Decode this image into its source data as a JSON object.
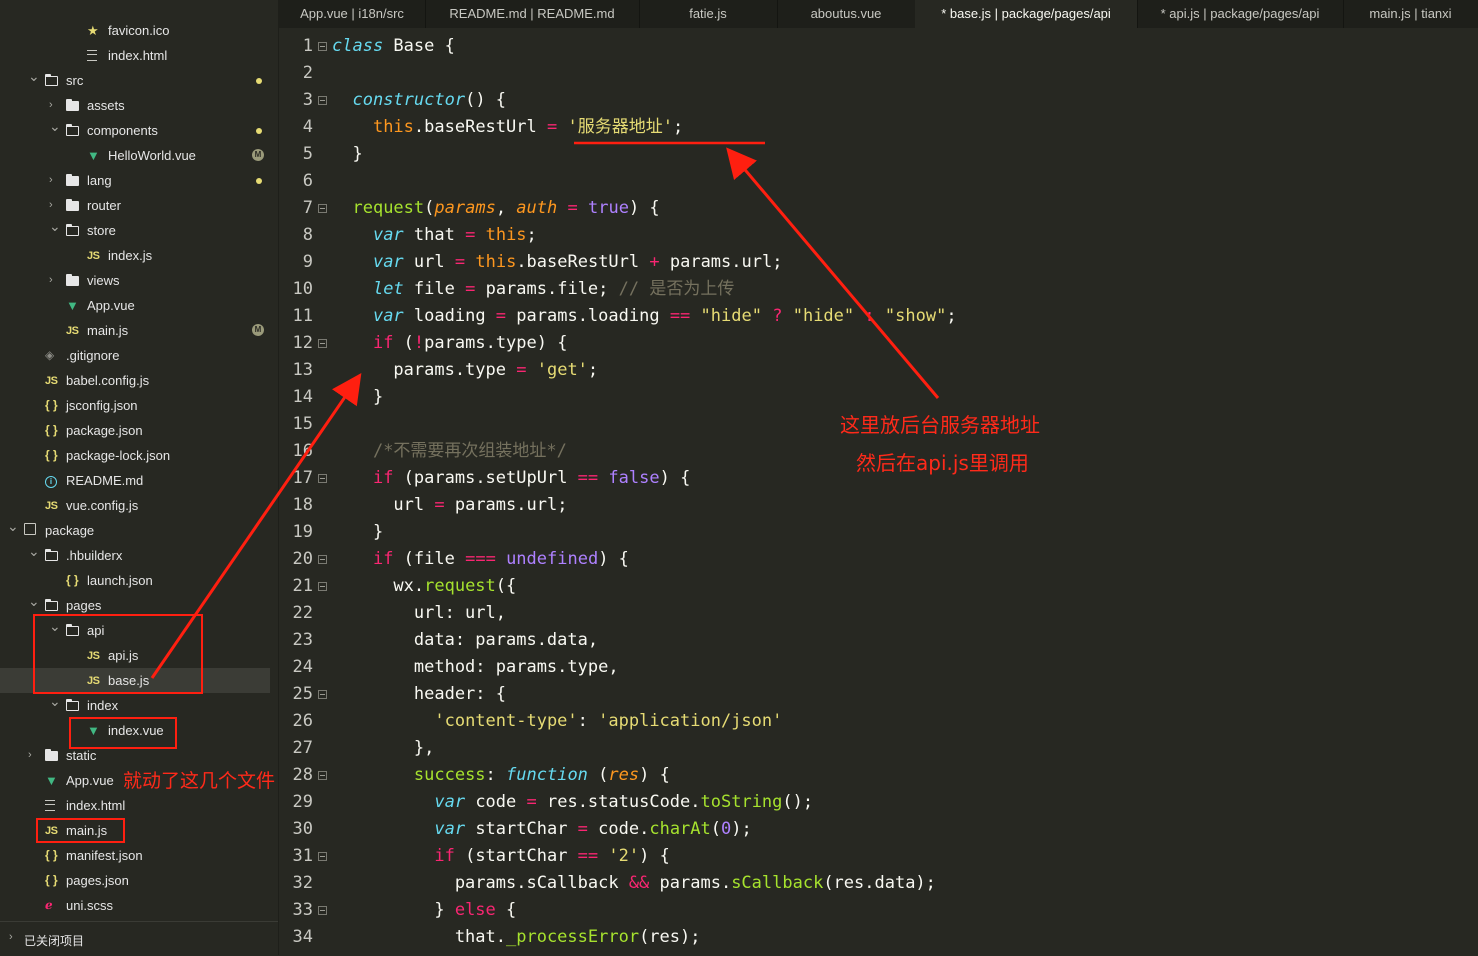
{
  "sidebar": {
    "items": [
      {
        "label": "favicon.ico",
        "icon": "star-icon",
        "indent": 4,
        "chevron": "none",
        "badge": ""
      },
      {
        "label": "index.html",
        "icon": "html-file-icon",
        "indent": 4,
        "chevron": "none",
        "badge": ""
      },
      {
        "label": "src",
        "icon": "folder-open-icon",
        "indent": 2,
        "chevron": "down",
        "badge": "dot"
      },
      {
        "label": "assets",
        "icon": "folder-icon",
        "indent": 3,
        "chevron": "right",
        "badge": ""
      },
      {
        "label": "components",
        "icon": "folder-open-icon",
        "indent": 3,
        "chevron": "down",
        "badge": "dot"
      },
      {
        "label": "HelloWorld.vue",
        "icon": "vue-file-icon",
        "indent": 4,
        "chevron": "none",
        "badge": "M"
      },
      {
        "label": "lang",
        "icon": "folder-icon",
        "indent": 3,
        "chevron": "right",
        "badge": "dot"
      },
      {
        "label": "router",
        "icon": "folder-icon",
        "indent": 3,
        "chevron": "right",
        "badge": ""
      },
      {
        "label": "store",
        "icon": "folder-open-icon",
        "indent": 3,
        "chevron": "down",
        "badge": ""
      },
      {
        "label": "index.js",
        "icon": "js-file-icon",
        "indent": 4,
        "chevron": "none",
        "badge": ""
      },
      {
        "label": "views",
        "icon": "folder-icon",
        "indent": 3,
        "chevron": "right",
        "badge": ""
      },
      {
        "label": "App.vue",
        "icon": "vue-file-icon",
        "indent": 3,
        "chevron": "none",
        "badge": ""
      },
      {
        "label": "main.js",
        "icon": "js-file-icon",
        "indent": 3,
        "chevron": "none",
        "badge": "M"
      },
      {
        "label": ".gitignore",
        "icon": "git-file-icon",
        "indent": 2,
        "chevron": "none",
        "badge": ""
      },
      {
        "label": "babel.config.js",
        "icon": "js-file-icon",
        "indent": 2,
        "chevron": "none",
        "badge": ""
      },
      {
        "label": "jsconfig.json",
        "icon": "json-file-icon",
        "indent": 2,
        "chevron": "none",
        "badge": ""
      },
      {
        "label": "package.json",
        "icon": "json-file-icon",
        "indent": 2,
        "chevron": "none",
        "badge": ""
      },
      {
        "label": "package-lock.json",
        "icon": "json-file-icon",
        "indent": 2,
        "chevron": "none",
        "badge": ""
      },
      {
        "label": "README.md",
        "icon": "info-file-icon",
        "indent": 2,
        "chevron": "none",
        "badge": ""
      },
      {
        "label": "vue.config.js",
        "icon": "js-file-icon",
        "indent": 2,
        "chevron": "none",
        "badge": ""
      },
      {
        "label": "package",
        "icon": "package-icon",
        "indent": 1,
        "chevron": "down",
        "badge": ""
      },
      {
        "label": ".hbuilderx",
        "icon": "folder-open-icon",
        "indent": 2,
        "chevron": "down",
        "badge": ""
      },
      {
        "label": "launch.json",
        "icon": "json-file-icon",
        "indent": 3,
        "chevron": "none",
        "badge": ""
      },
      {
        "label": "pages",
        "icon": "folder-open-icon",
        "indent": 2,
        "chevron": "down",
        "badge": ""
      },
      {
        "label": "api",
        "icon": "folder-open-icon",
        "indent": 3,
        "chevron": "down",
        "badge": ""
      },
      {
        "label": "api.js",
        "icon": "js-file-icon",
        "indent": 4,
        "chevron": "none",
        "badge": ""
      },
      {
        "label": "base.js",
        "icon": "js-file-icon",
        "indent": 4,
        "chevron": "none",
        "badge": "",
        "selected": true
      },
      {
        "label": "index",
        "icon": "folder-open-icon",
        "indent": 3,
        "chevron": "down",
        "badge": ""
      },
      {
        "label": "index.vue",
        "icon": "vue-file-icon",
        "indent": 4,
        "chevron": "none",
        "badge": ""
      },
      {
        "label": "static",
        "icon": "folder-icon",
        "indent": 2,
        "chevron": "right",
        "badge": ""
      },
      {
        "label": "App.vue",
        "icon": "vue-file-icon",
        "indent": 2,
        "chevron": "none",
        "badge": ""
      },
      {
        "label": "index.html",
        "icon": "html-file-icon",
        "indent": 2,
        "chevron": "none",
        "badge": ""
      },
      {
        "label": "main.js",
        "icon": "js-file-icon",
        "indent": 2,
        "chevron": "none",
        "badge": ""
      },
      {
        "label": "manifest.json",
        "icon": "json-file-icon",
        "indent": 2,
        "chevron": "none",
        "badge": ""
      },
      {
        "label": "pages.json",
        "icon": "json-file-icon",
        "indent": 2,
        "chevron": "none",
        "badge": ""
      },
      {
        "label": "uni.scss",
        "icon": "scss-file-icon",
        "indent": 2,
        "chevron": "none",
        "badge": ""
      }
    ],
    "footer_label": "已关闭项目"
  },
  "tabs": [
    {
      "label": "App.vue | i18n/src",
      "active": false
    },
    {
      "label": "README.md | README.md",
      "active": false
    },
    {
      "label": "fatie.js",
      "active": false
    },
    {
      "label": "aboutus.vue",
      "active": false
    },
    {
      "label": "* base.js | package/pages/api",
      "active": true
    },
    {
      "label": "* api.js | package/pages/api",
      "active": false
    },
    {
      "label": "main.js | tianxi",
      "active": false
    }
  ],
  "editor": {
    "lines": [
      {
        "n": 1,
        "fold": true,
        "html": "<span class='k'>class</span> Base {"
      },
      {
        "n": 2,
        "fold": false,
        "html": ""
      },
      {
        "n": 3,
        "fold": true,
        "html": "  <span class='k'>constructor</span>() {"
      },
      {
        "n": 4,
        "fold": false,
        "html": "    <span class='t'>this</span>.baseRestUrl <span class='op'>=</span> <span class='s'>'服务器地址'</span>;"
      },
      {
        "n": 5,
        "fold": false,
        "html": "  }"
      },
      {
        "n": 6,
        "fold": false,
        "html": ""
      },
      {
        "n": 7,
        "fold": true,
        "html": "  <span class='f'>request</span>(<span class='p'>params</span>, <span class='p'>auth</span> <span class='op'>=</span> <span class='n'>true</span>) {"
      },
      {
        "n": 8,
        "fold": false,
        "html": "    <span class='k'>var</span> that <span class='op'>=</span> <span class='t'>this</span>;"
      },
      {
        "n": 9,
        "fold": false,
        "html": "    <span class='k'>var</span> url <span class='op'>=</span> <span class='t'>this</span>.baseRestUrl <span class='op'>+</span> params.url;"
      },
      {
        "n": 10,
        "fold": false,
        "html": "    <span class='k'>let</span> file <span class='op'>=</span> params.file; <span class='c'>// 是否为上传</span>"
      },
      {
        "n": 11,
        "fold": false,
        "html": "    <span class='k'>var</span> loading <span class='op'>=</span> params.loading <span class='op'>==</span> <span class='s'>\"hide\"</span> <span class='op'>?</span> <span class='s'>\"hide\"</span> <span class='op'>:</span> <span class='s'>\"show\"</span>;"
      },
      {
        "n": 12,
        "fold": true,
        "html": "    <span class='kw'>if</span> (<span class='op'>!</span>params.type) {"
      },
      {
        "n": 13,
        "fold": false,
        "html": "      params.type <span class='op'>=</span> <span class='s'>'get'</span>;"
      },
      {
        "n": 14,
        "fold": false,
        "html": "    }"
      },
      {
        "n": 15,
        "fold": false,
        "html": ""
      },
      {
        "n": 16,
        "fold": false,
        "html": "    <span class='c'>/*不需要再次组装地址*/</span>"
      },
      {
        "n": 17,
        "fold": true,
        "html": "    <span class='kw'>if</span> (params.setUpUrl <span class='op'>==</span> <span class='n'>false</span>) {"
      },
      {
        "n": 18,
        "fold": false,
        "html": "      url <span class='op'>=</span> params.url;"
      },
      {
        "n": 19,
        "fold": false,
        "html": "    }"
      },
      {
        "n": 20,
        "fold": true,
        "html": "    <span class='kw'>if</span> (file <span class='op'>===</span> <span class='n'>undefined</span>) {"
      },
      {
        "n": 21,
        "fold": true,
        "html": "      wx.<span class='f'>request</span>({"
      },
      {
        "n": 22,
        "fold": false,
        "html": "        url: url,"
      },
      {
        "n": 23,
        "fold": false,
        "html": "        data: params.data,"
      },
      {
        "n": 24,
        "fold": false,
        "html": "        method: params.type,"
      },
      {
        "n": 25,
        "fold": true,
        "html": "        header: {"
      },
      {
        "n": 26,
        "fold": false,
        "html": "          <span class='s'>'content-type'</span>: <span class='s'>'application/json'</span>"
      },
      {
        "n": 27,
        "fold": false,
        "html": "        },"
      },
      {
        "n": 28,
        "fold": true,
        "html": "        <span class='f'>success</span>: <span class='k'>function</span> (<span class='p'>res</span>) {"
      },
      {
        "n": 29,
        "fold": false,
        "html": "          <span class='k'>var</span> code <span class='op'>=</span> res.statusCode.<span class='f'>toString</span>();"
      },
      {
        "n": 30,
        "fold": false,
        "html": "          <span class='k'>var</span> startChar <span class='op'>=</span> code.<span class='f'>charAt</span>(<span class='n'>0</span>);"
      },
      {
        "n": 31,
        "fold": true,
        "html": "          <span class='kw'>if</span> (startChar <span class='op'>==</span> <span class='s'>'2'</span>) {"
      },
      {
        "n": 32,
        "fold": false,
        "html": "            params.sCallback <span class='op'>&amp;&amp;</span> params.<span class='f'>sCallback</span>(res.data);"
      },
      {
        "n": 33,
        "fold": true,
        "html": "          } <span class='kw'>else</span> {"
      },
      {
        "n": 34,
        "fold": false,
        "html": "            that.<span class='f'>_processError</span>(res);"
      }
    ]
  },
  "annotations": {
    "server_note_line1": "这里放后台服务器地址",
    "server_note_line2": "然后在api.js里调用",
    "files_note": "就动了这几个文件",
    "color": "#ff1f10"
  }
}
